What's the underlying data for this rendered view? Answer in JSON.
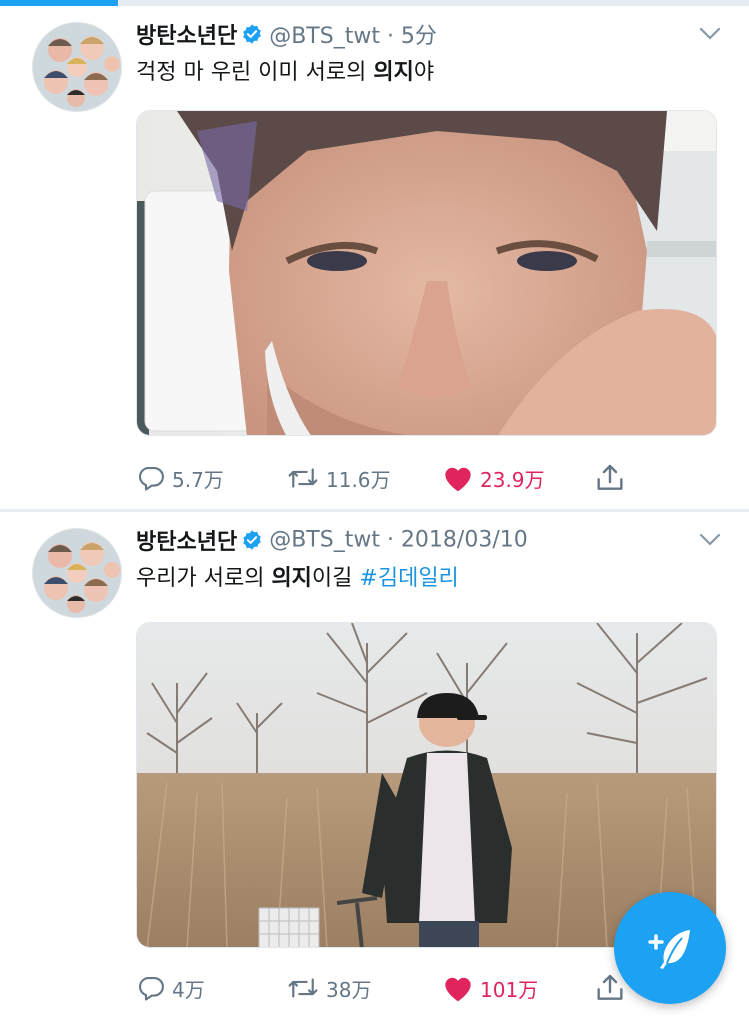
{
  "tweets": [
    {
      "name": "방탄소년단",
      "handle": "@BTS_twt · 5分",
      "text_parts": [
        "걱정 마 우린 이미 서로의 ",
        "의지",
        "야"
      ],
      "media_desc": "selfie-photo",
      "actions": {
        "replies": "5.7万",
        "retweets": "11.6万",
        "likes": "23.9万"
      }
    },
    {
      "name": "방탄소년단",
      "handle": "@BTS_twt · 2018/03/10",
      "text_parts": [
        "우리가 서로의 ",
        "의지",
        "이길 "
      ],
      "hashtag": "#김데일리",
      "media_desc": "field-photo",
      "actions": {
        "replies": "4万",
        "retweets": "38万",
        "likes": "101万"
      }
    }
  ],
  "colors": {
    "accent": "#1da1f2",
    "like": "#e0245e",
    "muted": "#657786",
    "hashtag": "#1b95e0"
  },
  "icons": [
    "verified-badge-icon",
    "chevron-down-icon",
    "reply-icon",
    "retweet-icon",
    "heart-icon",
    "share-icon",
    "compose-tweet-icon"
  ]
}
